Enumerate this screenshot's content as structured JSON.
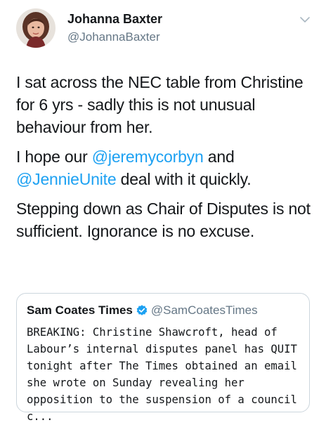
{
  "author": {
    "name": "Johanna Baxter",
    "handle": "@JohannaBaxter"
  },
  "tweet": {
    "p1": "I sat across the NEC table from Christine for 6 yrs - sadly this is not unusual behaviour from her.",
    "p2_pre": "I hope our ",
    "mention1": "@jeremycorbyn",
    "p2_mid": " and ",
    "mention2": "@JennieUnite",
    "p2_post": " deal with it quickly.",
    "p3": "Stepping down as Chair of Disputes is not sufficient. Ignorance is no excuse."
  },
  "quoted": {
    "name": "Sam Coates Times",
    "handle": "@SamCoatesTimes",
    "text": "BREAKING: Christine Shawcroft, head of Labour’s internal disputes panel has QUIT tonight after The Times obtained an email she wrote on Sunday revealing her opposition to the suspension of a council c..."
  },
  "icons": {
    "menu": "chevron-down-icon",
    "verified": "verified-badge-icon"
  },
  "colors": {
    "text": "#14171a",
    "secondary": "#657786",
    "link": "#1da1f2",
    "border": "#ccd6dd"
  }
}
